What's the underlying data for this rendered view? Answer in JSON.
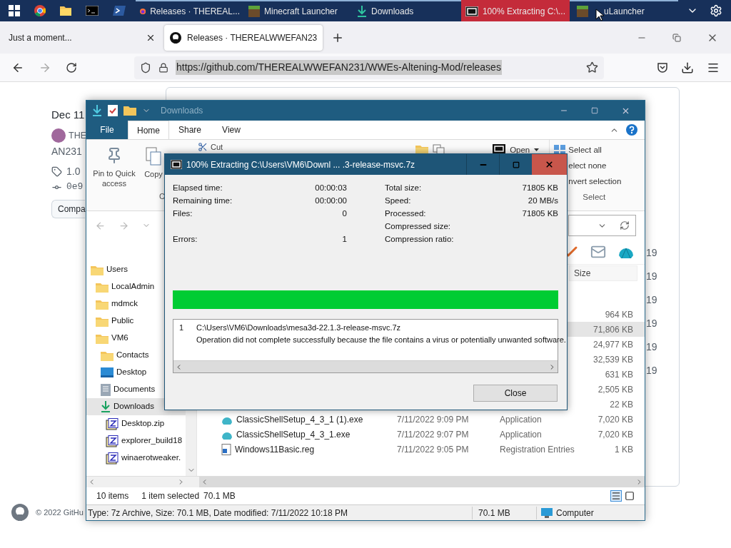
{
  "taskbar": {
    "buttons": [
      {
        "label": "Releases · THEREAL...",
        "kind": "firefox",
        "selected": false
      },
      {
        "label": "Minecraft Launcher",
        "kind": "block",
        "selected": false
      },
      {
        "label": "Downloads",
        "kind": "download",
        "selected": false
      },
      {
        "label": "100% Extracting C:\\...",
        "kind": "archive",
        "selected": true
      },
      {
        "label": "uLauncher",
        "kind": "block",
        "selected": false
      }
    ]
  },
  "browser": {
    "tabs": [
      {
        "label": "Just a moment...",
        "selected": false
      },
      {
        "label": "Releases · THEREALWWEFAN23",
        "selected": true
      }
    ],
    "url": "https://github.com/THEREALWWEFAN231/WWEs-Altening-Mod/releases",
    "url_selected": true
  },
  "page": {
    "date": "Dec 11",
    "author": "THE",
    "author_line2": "AN231",
    "tag": "1.0",
    "commit": "0e9",
    "compare_button": "Compa",
    "counts": [
      "19",
      "19",
      "19",
      "19",
      "19",
      "19"
    ],
    "footer": "© 2022 GitHu"
  },
  "explorer": {
    "title": "Downloads",
    "ribbon_tabs": [
      {
        "label": "File",
        "kind": "file",
        "selected": false
      },
      {
        "label": "Home",
        "kind": "tab",
        "selected": true
      },
      {
        "label": "Share",
        "kind": "tab",
        "selected": false
      },
      {
        "label": "View",
        "kind": "tab",
        "selected": false
      }
    ],
    "ribbon": {
      "pin": "Pin to Quick access",
      "copy": "Copy",
      "cut": "Cut",
      "clipboard_group": "C",
      "open": "Open",
      "select_group": "Select",
      "select_items": [
        {
          "label": "Select all",
          "kind": "all"
        },
        {
          "label": "elect none",
          "kind": "none"
        },
        {
          "label": "nvert selection",
          "kind": "invert"
        }
      ]
    },
    "nav_tree": [
      {
        "label": "Users",
        "kind": "folder",
        "selected": false,
        "children": [
          {
            "label": "LocalAdmin",
            "kind": "folder",
            "selected": false
          },
          {
            "label": "mdmck",
            "kind": "folder",
            "selected": false
          },
          {
            "label": "Public",
            "kind": "folder",
            "selected": false
          },
          {
            "label": "VM6",
            "kind": "folder",
            "selected": false,
            "children": [
              {
                "label": "Contacts",
                "kind": "folder",
                "selected": false
              },
              {
                "label": "Desktop",
                "kind": "desktop",
                "selected": false
              },
              {
                "label": "Documents",
                "kind": "documents",
                "selected": false
              },
              {
                "label": "Downloads",
                "kind": "download",
                "selected": true,
                "children": [
                  {
                    "label": "Desktop.zip",
                    "kind": "zip",
                    "selected": false
                  },
                  {
                    "label": "explorer_build18",
                    "kind": "zip",
                    "selected": false
                  },
                  {
                    "label": "winaerotweaker.",
                    "kind": "zip",
                    "selected": false
                  }
                ]
              }
            ]
          }
        ]
      }
    ],
    "size_header": "Size",
    "rows": [
      {
        "size": "964 KB",
        "selected": false
      },
      {
        "size": "71,806 KB",
        "selected": true
      },
      {
        "size": "24,977 KB",
        "selected": false
      },
      {
        "size": "32,539 KB",
        "selected": false
      },
      {
        "size": "631 KB",
        "selected": false
      },
      {
        "size": "2,505 KB",
        "selected": false
      },
      {
        "size": "22 KB",
        "selected": false
      },
      {
        "name": "ClassicShellSetup_4_3_1 (1).exe",
        "kind": "shell",
        "date": "7/11/2022 9:09 PM",
        "type": "Application",
        "size": "7,020 KB",
        "selected": false
      },
      {
        "name": "ClassicShellSetup_4_3_1.exe",
        "kind": "shell",
        "date": "7/11/2022 9:07 PM",
        "type": "Application",
        "size": "7,020 KB",
        "selected": false
      },
      {
        "name": "Windows11Basic.reg",
        "kind": "registry",
        "date": "7/11/2022 9:05 PM",
        "type": "Registration Entries",
        "size": "1 KB",
        "selected": false
      }
    ],
    "status": {
      "count": "10 items",
      "selection": "1 item selected",
      "size": "70.1 MB"
    },
    "details": {
      "info": "Type: 7z Archive, Size: 70.1 MB, Date modified: 7/11/2022 10:18 PM",
      "size": "70.1 MB",
      "location": "Computer"
    }
  },
  "dialog": {
    "title": "100% Extracting C:\\Users\\VM6\\Downl ... .3-release-msvc.7z",
    "stats": [
      {
        "left_label": "Elapsed time:",
        "left_value": "00:00:03",
        "right_label": "Total size:",
        "right_value": "71805 KB"
      },
      {
        "left_label": "Remaining time:",
        "left_value": "00:00:00",
        "right_label": "Speed:",
        "right_value": "20 MB/s"
      },
      {
        "left_label": "Files:",
        "left_value": "0",
        "right_label": "Processed:",
        "right_value": "71805 KB"
      },
      {
        "right_label": "Compressed size:"
      },
      {
        "left_label": "Errors:",
        "left_value": "1",
        "right_label": "Compression ratio:"
      }
    ],
    "level": 1,
    "log": [
      {
        "number": "1",
        "path": "C:\\Users\\VM6\\Downloads\\mesa3d-22.1.3-release-msvc.7z",
        "message": "Operation did not complete successfully because the file contains a virus or potentially unwanted software."
      }
    ],
    "close_button": "Close"
  }
}
